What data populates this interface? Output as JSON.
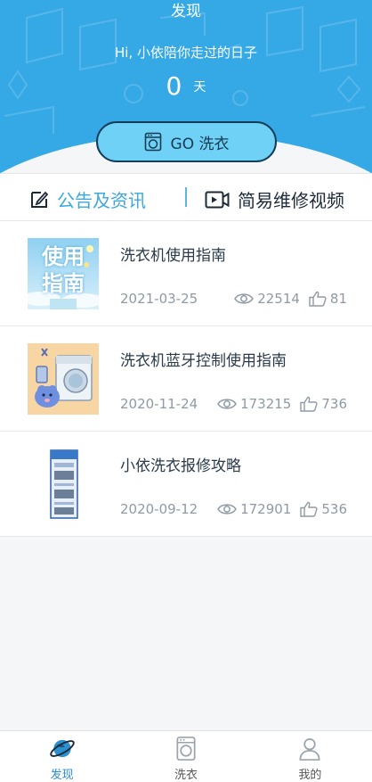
{
  "header": {
    "title": "发现",
    "greeting": "Hi, 小依陪你走过的日子",
    "days_count": "0",
    "days_unit": "天",
    "go_button_label": "GO 洗衣"
  },
  "tabs": [
    {
      "label": "公告及资讯",
      "icon": "edit-note-icon",
      "active": true
    },
    {
      "label": "简易维修视频",
      "icon": "video-camera-icon",
      "active": false
    }
  ],
  "articles": [
    {
      "title": "洗衣机使用指南",
      "date": "2021-03-25",
      "views": "22514",
      "likes": "81",
      "thumb_text": [
        "使用",
        "指南"
      ]
    },
    {
      "title": "洗衣机蓝牙控制使用指南",
      "date": "2020-11-24",
      "views": "173215",
      "likes": "736"
    },
    {
      "title": "小依洗衣报修攻略",
      "date": "2020-09-12",
      "views": "172901",
      "likes": "536"
    }
  ],
  "bottom_nav": [
    {
      "label": "发现",
      "icon": "planet-icon",
      "active": true
    },
    {
      "label": "洗衣",
      "icon": "washing-machine-icon",
      "active": false
    },
    {
      "label": "我的",
      "icon": "user-icon",
      "active": false
    }
  ],
  "colors": {
    "header_blue": "#35a8e6",
    "button_fill": "#6ed1f5",
    "accent_blue": "#3ba8dc",
    "muted_text": "#8f9aa5"
  }
}
